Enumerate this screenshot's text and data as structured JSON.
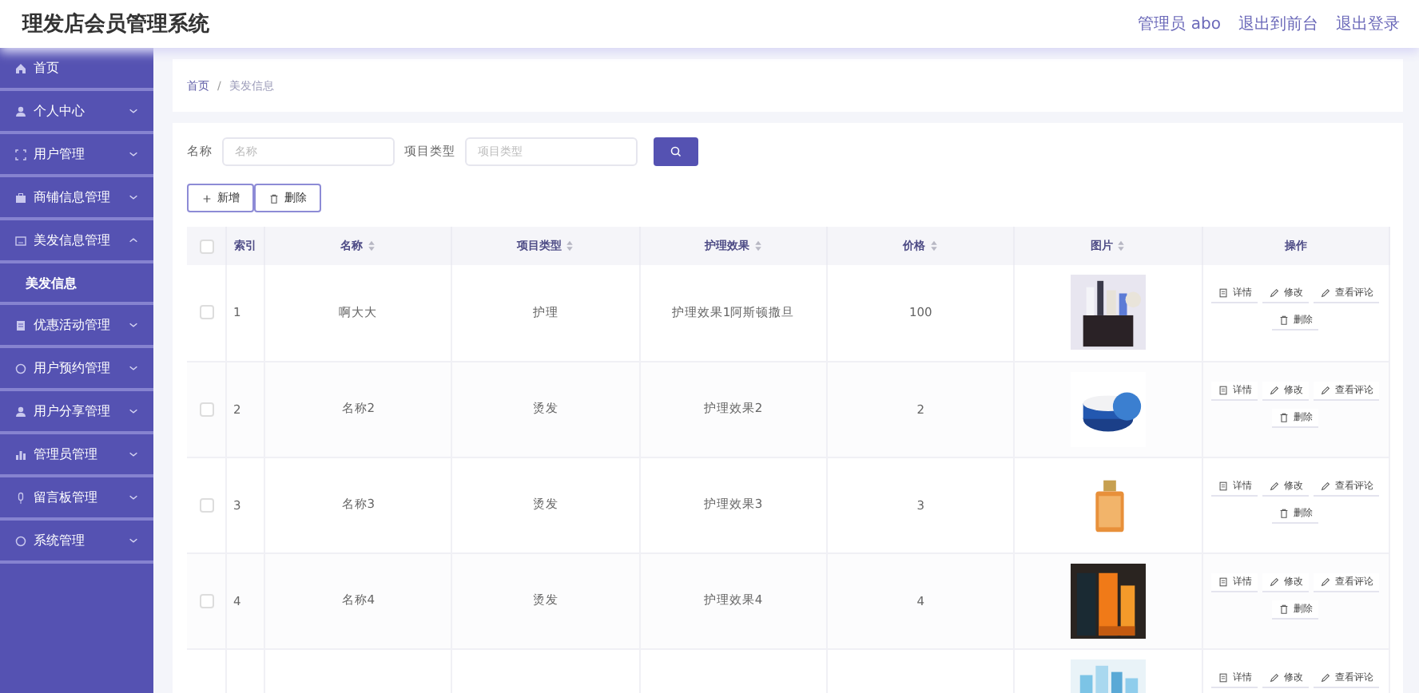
{
  "header": {
    "title": "理发店会员管理系统",
    "links": [
      "管理员 abo",
      "退出到前台",
      "退出登录"
    ]
  },
  "sidebar": {
    "items": [
      {
        "label": "首页"
      },
      {
        "label": "个人中心",
        "expanded": false
      },
      {
        "label": "用户管理",
        "expanded": false
      },
      {
        "label": "商铺信息管理",
        "expanded": false
      },
      {
        "label": "美发信息管理",
        "expanded": true,
        "children": [
          {
            "label": "美发信息",
            "selected": true
          }
        ]
      },
      {
        "label": "优惠活动管理",
        "expanded": false
      },
      {
        "label": "用户预约管理",
        "expanded": false
      },
      {
        "label": "用户分享管理",
        "expanded": false
      },
      {
        "label": "管理员管理",
        "expanded": false
      },
      {
        "label": "留言板管理",
        "expanded": false
      },
      {
        "label": "系统管理",
        "expanded": false
      }
    ]
  },
  "breadcrumb": {
    "items": [
      "首页",
      "美发信息"
    ],
    "separator": "/"
  },
  "search": {
    "fields": [
      {
        "label": "名称",
        "placeholder": "名称"
      },
      {
        "label": "项目类型",
        "placeholder": "项目类型"
      }
    ]
  },
  "toolbar": [
    {
      "label": "新增",
      "kind": "add"
    },
    {
      "label": "删除",
      "kind": "delete"
    }
  ],
  "table": {
    "columns": [
      {
        "label": "索引",
        "sortable": false
      },
      {
        "label": "名称",
        "sortable": true
      },
      {
        "label": "项目类型",
        "sortable": true
      },
      {
        "label": "护理效果",
        "sortable": true
      },
      {
        "label": "价格",
        "sortable": true
      },
      {
        "label": "图片",
        "sortable": true
      },
      {
        "label": "操作",
        "sortable": false
      }
    ],
    "header_checked": false,
    "rows": [
      {
        "checked": false,
        "cells": [
          "1",
          "啊大大",
          "护理",
          "护理效果1阿斯顿撒旦",
          "100"
        ],
        "actions": [
          {
            "label": "详情",
            "kind": "detail"
          },
          {
            "label": "修改",
            "kind": "edit"
          },
          {
            "label": "查看评论",
            "kind": "edit"
          },
          {
            "label": "删除",
            "kind": "delete"
          }
        ]
      },
      {
        "checked": false,
        "cells": [
          "2",
          "名称2",
          "烫发",
          "护理效果2",
          "2"
        ],
        "actions": [
          {
            "label": "详情",
            "kind": "detail"
          },
          {
            "label": "修改",
            "kind": "edit"
          },
          {
            "label": "查看评论",
            "kind": "edit"
          },
          {
            "label": "删除",
            "kind": "delete"
          }
        ]
      },
      {
        "checked": false,
        "cells": [
          "3",
          "名称3",
          "烫发",
          "护理效果3",
          "3"
        ],
        "actions": [
          {
            "label": "详情",
            "kind": "detail"
          },
          {
            "label": "修改",
            "kind": "edit"
          },
          {
            "label": "查看评论",
            "kind": "edit"
          },
          {
            "label": "删除",
            "kind": "delete"
          }
        ]
      },
      {
        "checked": false,
        "cells": [
          "4",
          "名称4",
          "烫发",
          "护理效果4",
          "4"
        ],
        "actions": [
          {
            "label": "详情",
            "kind": "detail"
          },
          {
            "label": "修改",
            "kind": "edit"
          },
          {
            "label": "查看评论",
            "kind": "edit"
          },
          {
            "label": "删除",
            "kind": "delete"
          }
        ]
      },
      {
        "cells": [],
        "actions": [
          {
            "label": "详情",
            "kind": "detail"
          },
          {
            "label": "修改",
            "kind": "edit"
          },
          {
            "label": "查看评论",
            "kind": "edit"
          }
        ]
      }
    ]
  }
}
